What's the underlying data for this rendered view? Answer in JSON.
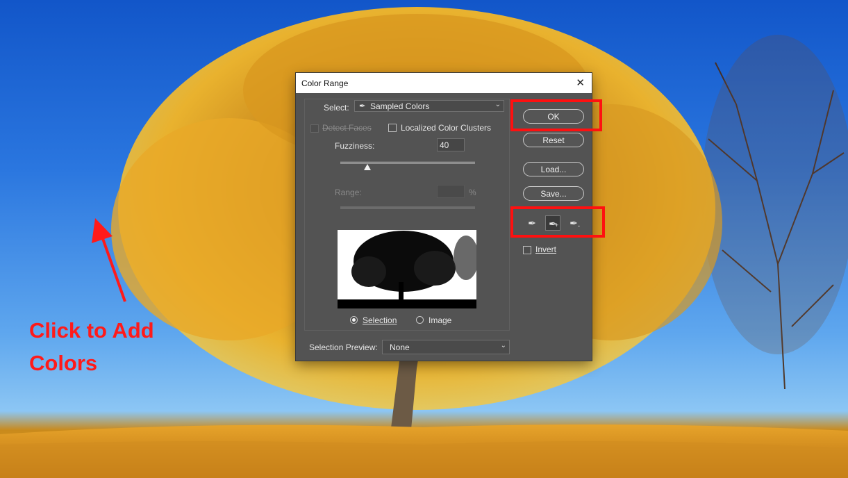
{
  "annotation": {
    "text_line1": "Click to Add",
    "text_line2": "Colors",
    "color": "#ff1a1a"
  },
  "dialog": {
    "title": "Color Range",
    "close_icon": "close-icon",
    "select_label": "Select:",
    "select_value": "Sampled Colors",
    "select_icon": "eyedropper-icon",
    "detect_faces_label": "Detect Faces",
    "localized_clusters_label": "Localized Color Clusters",
    "fuzziness_label": "Fuzziness:",
    "fuzziness_value": "40",
    "fuzziness_fraction": 0.2,
    "range_label": "Range:",
    "range_value": "",
    "range_unit": "%",
    "radio_selection_label": "Selection",
    "radio_image_label": "Image",
    "selected_radio": "Selection",
    "selection_preview_label": "Selection Preview:",
    "selection_preview_value": "None",
    "buttons": {
      "ok": "OK",
      "reset": "Reset",
      "load": "Load...",
      "save": "Save..."
    },
    "tools": [
      "eyedropper-icon",
      "eyedropper-plus-icon",
      "eyedropper-minus-icon"
    ],
    "active_tool": "eyedropper-plus-icon",
    "invert_label": "Invert",
    "highlight_color": "#ff1010"
  }
}
